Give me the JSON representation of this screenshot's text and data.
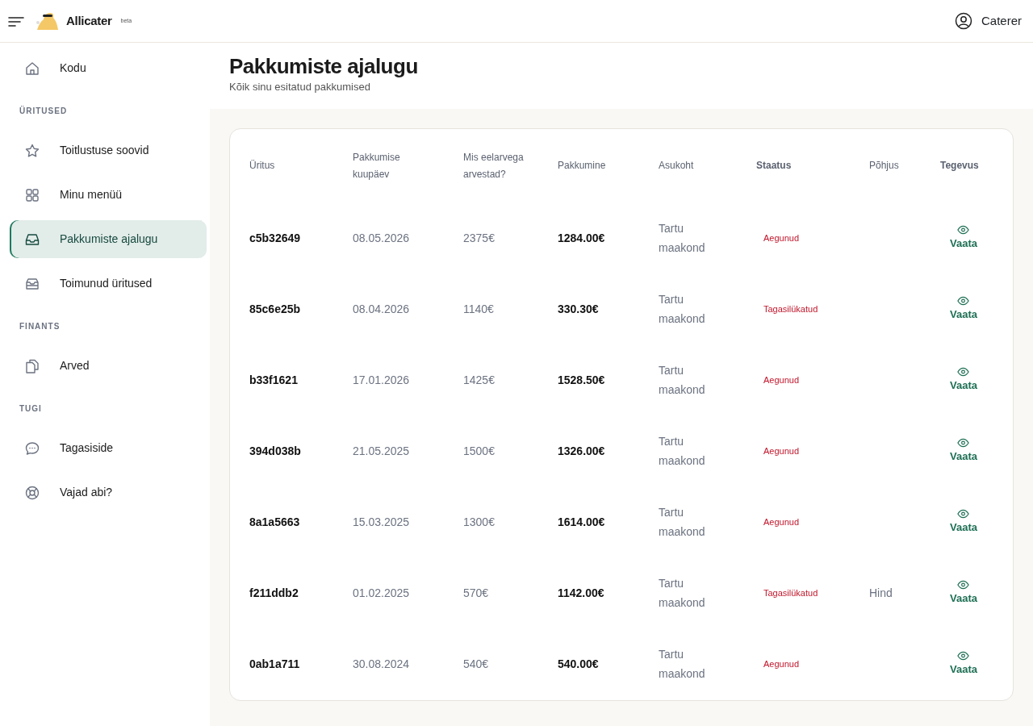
{
  "brand": {
    "name": "Allicater",
    "tag": "beta"
  },
  "user": {
    "name": "Caterer"
  },
  "sidebar": {
    "groups": [
      {
        "items": [
          {
            "label": "Kodu",
            "selected": false
          }
        ]
      },
      {
        "heading": "ÜRITUSED",
        "items": [
          {
            "label": "Toitlustuse soovid",
            "selected": false
          },
          {
            "label": "Minu menüü",
            "selected": false
          },
          {
            "label": "Pakkumiste ajalugu",
            "selected": true
          },
          {
            "label": "Toimunud üritused",
            "selected": false
          }
        ]
      },
      {
        "heading": "FINANTS",
        "items": [
          {
            "label": "Arved",
            "selected": false
          }
        ]
      },
      {
        "heading": "TUGI",
        "items": [
          {
            "label": "Tagasiside",
            "selected": false
          },
          {
            "label": "Vajad abi?",
            "selected": false
          }
        ]
      }
    ]
  },
  "page": {
    "title": "Pakkumiste ajalugu",
    "subtitle": "Kõik sinu esitatud pakkumised"
  },
  "table": {
    "columns": [
      {
        "label": "Üritus",
        "bold": false
      },
      {
        "label": "Pakkumise kuupäev",
        "bold": false
      },
      {
        "label": "Mis eelarvega arvestad?",
        "bold": false
      },
      {
        "label": "Pakkumine",
        "bold": false
      },
      {
        "label": "Asukoht",
        "bold": false
      },
      {
        "label": "Staatus",
        "bold": true
      },
      {
        "label": "Põhjus",
        "bold": false
      },
      {
        "label": "Tegevus",
        "bold": true
      }
    ],
    "rows": [
      {
        "id": "c5b32649",
        "date": "08.05.2026",
        "budget": "2375€",
        "offer": "1284.00€",
        "location": "Tartu maakond",
        "status": "Aegunud",
        "action": "Vaata"
      },
      {
        "id": "85c6e25b",
        "date": "08.04.2026",
        "budget": "1140€",
        "offer": "330.30€",
        "location": "Tartu maakond",
        "status": "Tagasilükatud",
        "action": "Vaata"
      },
      {
        "id": "b33f1621",
        "date": "17.01.2026",
        "budget": "1425€",
        "offer": "1528.50€",
        "location": "Tartu maakond",
        "status": "Aegunud",
        "action": "Vaata"
      },
      {
        "id": "394d038b",
        "date": "21.05.2025",
        "budget": "1500€",
        "offer": "1326.00€",
        "location": "Tartu maakond",
        "status": "Aegunud",
        "action": "Vaata"
      },
      {
        "id": "8a1a5663",
        "date": "15.03.2025",
        "budget": "1300€",
        "offer": "1614.00€",
        "location": "Tartu maakond",
        "status": "Aegunud",
        "action": "Vaata"
      },
      {
        "id": "f211ddb2",
        "date": "01.02.2025",
        "budget": "570€",
        "offer": "1142.00€",
        "location": "Tartu maakond",
        "status": "Tagasilükatud",
        "reason": "Hind",
        "action": "Vaata"
      },
      {
        "id": "0ab1a711",
        "date": "30.08.2024",
        "budget": "540€",
        "offer": "540.00€",
        "location": "Tartu maakond",
        "status": "Aegunud",
        "action": "Vaata"
      }
    ]
  }
}
